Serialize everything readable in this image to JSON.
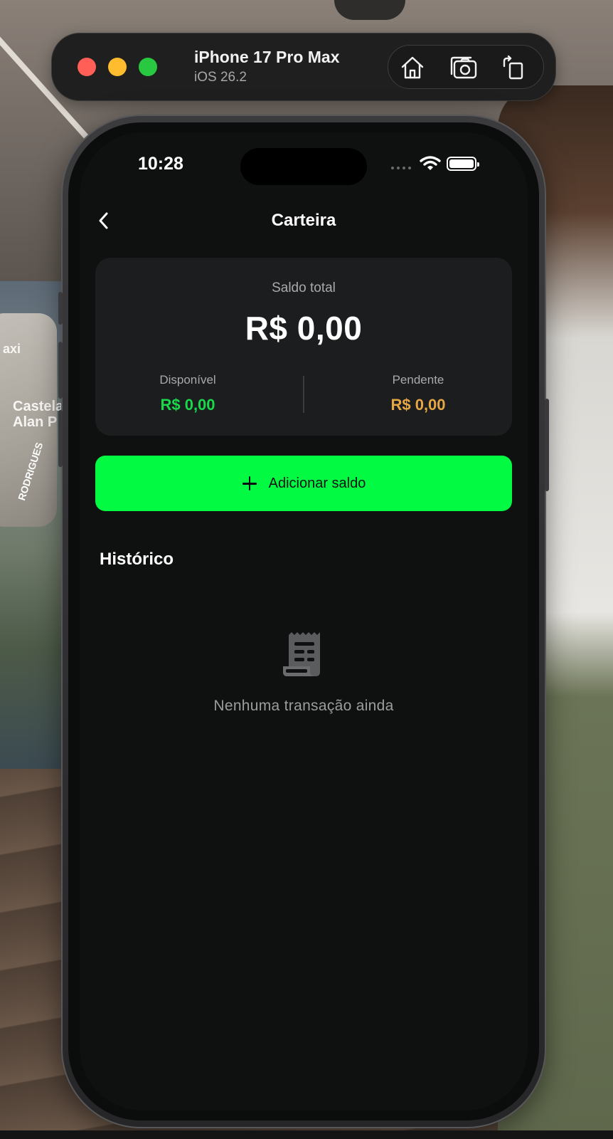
{
  "simulator": {
    "device_name": "iPhone 17 Pro Max",
    "os_version": "iOS 26.2",
    "actions": [
      "home-icon",
      "screenshot-icon",
      "rotate-icon"
    ]
  },
  "wallpaper_text": {
    "line0": "axi",
    "line1": "Castela",
    "line2": "Alan P",
    "line3": "RODRIGUES"
  },
  "status_bar": {
    "time": "10:28"
  },
  "nav": {
    "title": "Carteira",
    "back_icon": "chevron-left-icon"
  },
  "balance": {
    "label": "Saldo total",
    "total": "R$ 0,00",
    "available_label": "Disponível",
    "available_value": "R$ 0,00",
    "pending_label": "Pendente",
    "pending_value": "R$ 0,00"
  },
  "add_balance": {
    "label": "Adicionar saldo",
    "icon": "plus-icon"
  },
  "history": {
    "title": "Histórico",
    "empty_icon": "receipt-icon",
    "empty_message": "Nenhuma transação ainda"
  },
  "colors": {
    "accent_green": "#02fb42",
    "available_green": "#19d84b",
    "pending_orange": "#e7a744",
    "screen_bg": "#0f1010",
    "card_bg": "#1b1d1e"
  }
}
